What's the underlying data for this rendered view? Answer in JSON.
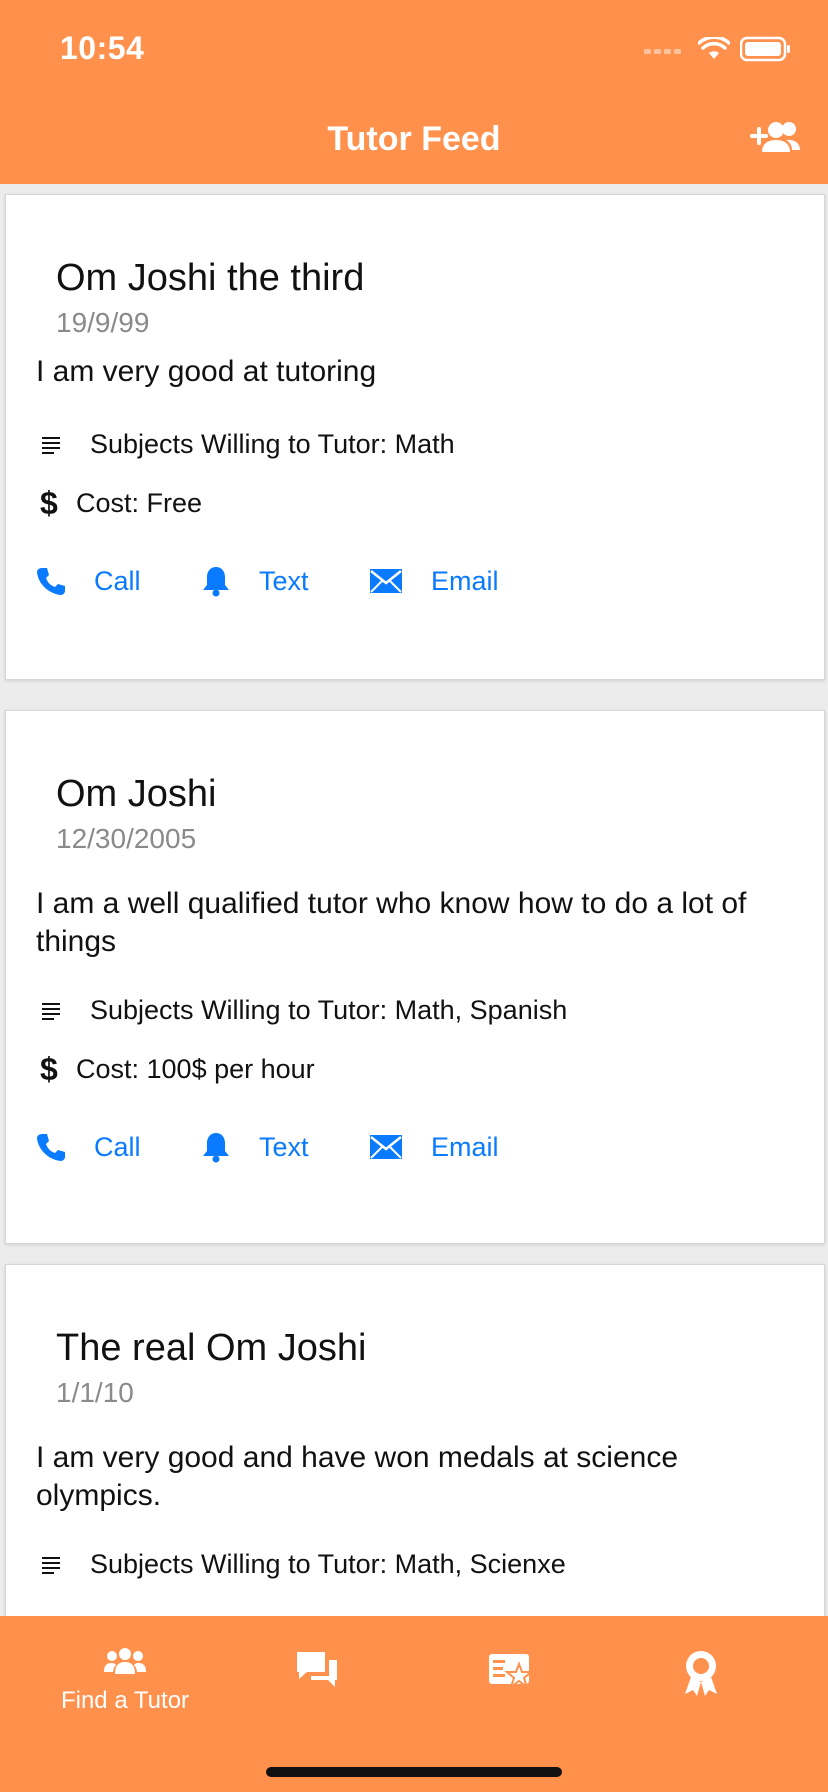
{
  "status_bar": {
    "time": "10:54"
  },
  "nav": {
    "title": "Tutor Feed"
  },
  "tutors": [
    {
      "name": "Om Joshi the third",
      "date": "19/9/99",
      "bio": "I  am very good at tutoring",
      "subjects": "Subjects Willing to Tutor: Math",
      "cost": "Cost: Free"
    },
    {
      "name": "Om Joshi",
      "date": "12/30/2005",
      "bio": "I am a well qualified tutor who know how to do a lot of things",
      "subjects": "Subjects Willing to Tutor: Math, Spanish",
      "cost": "Cost: 100$ per hour"
    },
    {
      "name": "The real Om Joshi",
      "date": "1/1/10",
      "bio": "I am very good and have won medals at science olympics.",
      "subjects": "Subjects Willing to Tutor: Math, Scienxe",
      "cost": ""
    }
  ],
  "actions": {
    "call": "Call",
    "text": "Text",
    "email": "Email"
  },
  "tabbar": {
    "tabs": [
      {
        "label": "Find a Tutor",
        "icon": "people-icon"
      },
      {
        "label": "",
        "icon": "chat-icon"
      },
      {
        "label": "",
        "icon": "cards-star-icon"
      },
      {
        "label": "",
        "icon": "award-icon"
      }
    ]
  },
  "colors": {
    "brand": "#ff914d",
    "link": "#0a7aff"
  }
}
